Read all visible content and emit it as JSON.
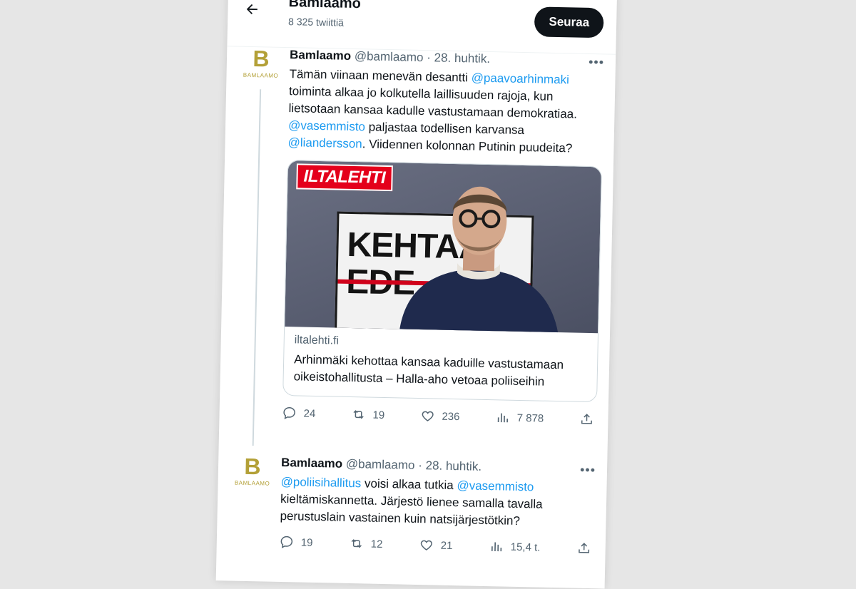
{
  "header": {
    "name": "Bamlaamo",
    "tweet_count": "8 325 twiittiä",
    "follow_label": "Seuraa"
  },
  "tweets": [
    {
      "avatar_letter": "B",
      "avatar_wordmark": "BAMLAAMO",
      "name": "Bamlaamo",
      "handle": "@bamlaamo",
      "separator": "·",
      "date": "28. huhtik.",
      "more": "•••",
      "text": {
        "p1": "Tämän viinaan menevän desantti ",
        "m1": "@paavoarhinmaki",
        "p2": " toiminta alkaa jo kolkutella laillisuuden rajoja, kun lietsotaan kansaa kadulle vastustamaan demokratiaa. ",
        "m2": "@vasemmisto",
        "p3": " paljastaa todellisen karvansa ",
        "m3": "@liandersson",
        "p4": ". Viidennen kolonnan Putinin puudeita?"
      },
      "card": {
        "logo": "ILTALEHTI",
        "sign_line1": "KEHTAA",
        "sign_line2": "EDE",
        "domain": "iltalehti.fi",
        "title": "Arhinmäki kehottaa kansaa kaduille vastustamaan oikeistohallitusta – Halla-aho vetoaa poliiseihin"
      },
      "replies": "24",
      "retweets": "19",
      "likes": "236",
      "views": "7 878"
    },
    {
      "avatar_letter": "B",
      "avatar_wordmark": "BAMLAAMO",
      "name": "Bamlaamo",
      "handle": "@bamlaamo",
      "separator": "·",
      "date": "28. huhtik.",
      "more": "•••",
      "text": {
        "m1": "@poliisihallitus",
        "p1": " voisi alkaa tutkia ",
        "m2": "@vasemmisto",
        "p2": " kieltämiskannetta. Järjestö lienee samalla tavalla perustuslain vastainen kuin natsijärjestötkin?"
      },
      "replies": "19",
      "retweets": "12",
      "likes": "21",
      "views": "15,4 t."
    }
  ]
}
